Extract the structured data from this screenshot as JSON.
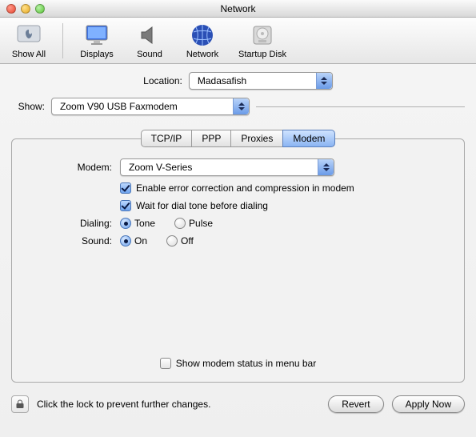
{
  "window": {
    "title": "Network"
  },
  "toolbar": {
    "showAll": "Show All",
    "displays": "Displays",
    "sound": "Sound",
    "network": "Network",
    "startupDisk": "Startup Disk"
  },
  "location": {
    "label": "Location:",
    "value": "Madasafish"
  },
  "show": {
    "label": "Show:",
    "value": "Zoom V90 USB Faxmodem"
  },
  "tabs": {
    "tcpip": "TCP/IP",
    "ppp": "PPP",
    "proxies": "Proxies",
    "modem": "Modem"
  },
  "modem": {
    "label": "Modem:",
    "value": "Zoom V-Series",
    "errorCorrection": "Enable error correction and compression in modem",
    "waitDialTone": "Wait for dial tone before dialing",
    "dialingLabel": "Dialing:",
    "tone": "Tone",
    "pulse": "Pulse",
    "soundLabel": "Sound:",
    "on": "On",
    "off": "Off",
    "showStatus": "Show modem status in menu bar"
  },
  "footer": {
    "lockText": "Click the lock to prevent further changes.",
    "revert": "Revert",
    "applyNow": "Apply Now"
  }
}
